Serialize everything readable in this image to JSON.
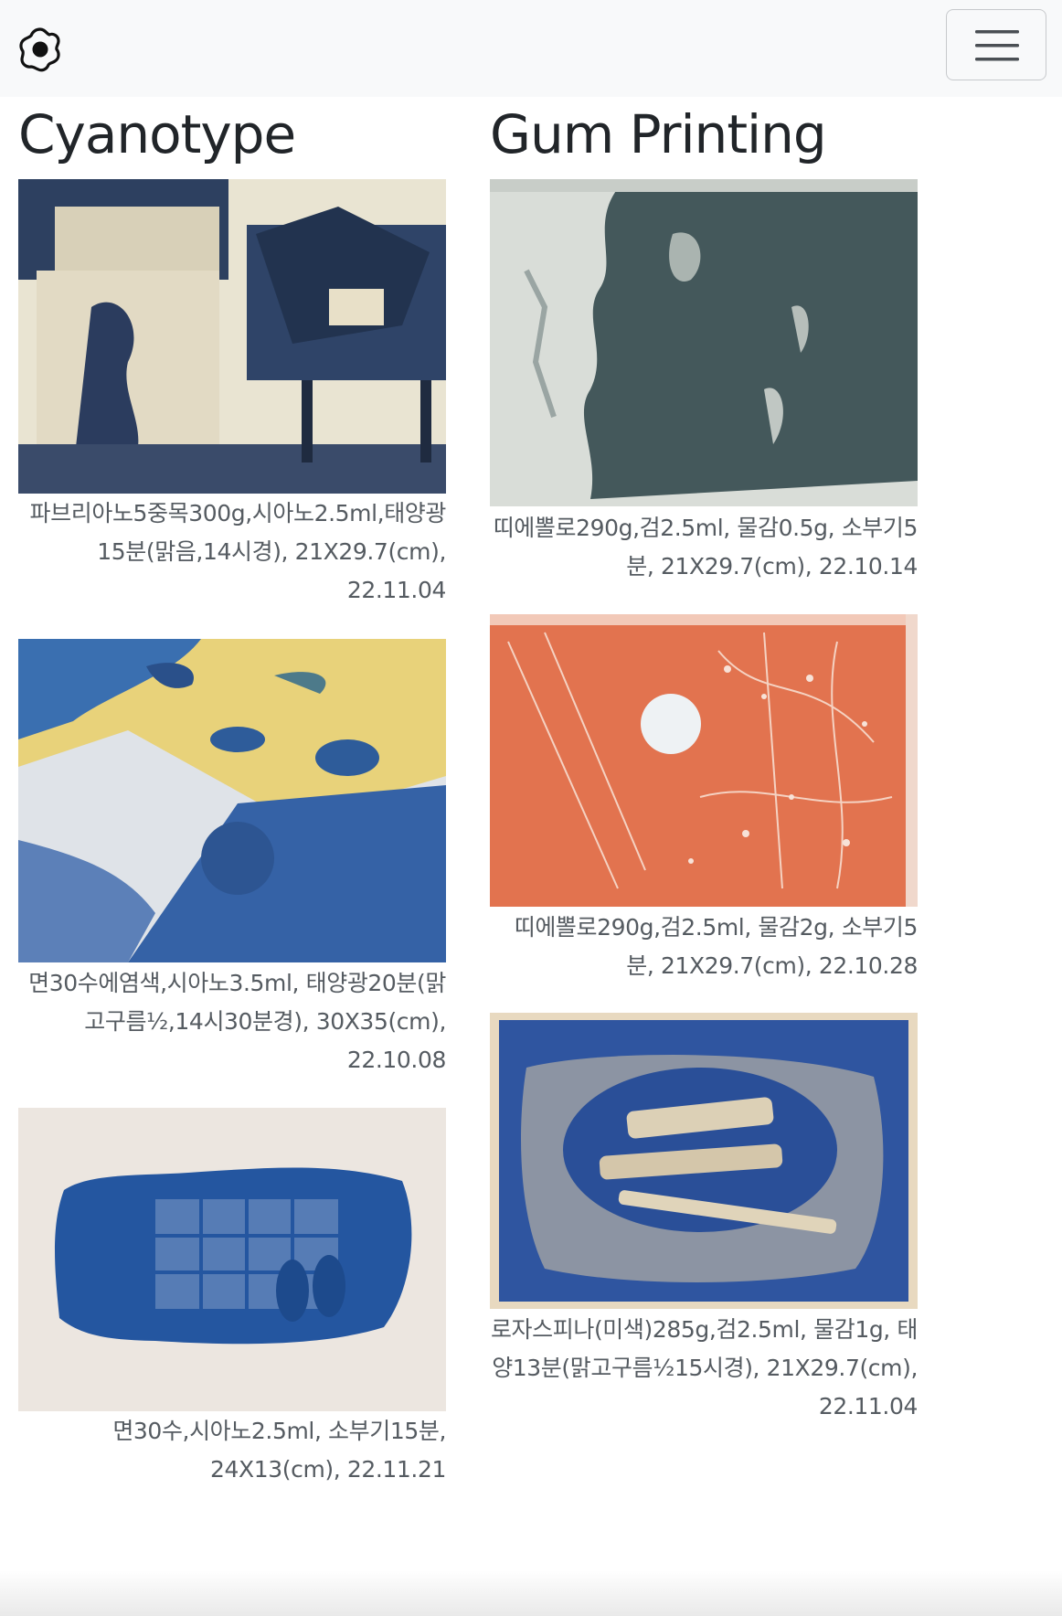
{
  "navbar": {
    "logo_icon": "flower-logo-icon",
    "menu_icon": "hamburger-menu-icon"
  },
  "columns": [
    {
      "title": "Cyanotype",
      "items": [
        {
          "caption": "파브리아노5중목300g,시아노2.5ml,태양광15분(맑음,14시경), 21X29.7(cm), 22.11.04"
        },
        {
          "caption": "면30수에염색,시아노3.5ml, 태양광20분(맑고구름½,14시30분경), 30X35(cm), 22.10.08"
        },
        {
          "caption": "면30수,시아노2.5ml, 소부기15분, 24X13(cm), 22.11.21"
        }
      ]
    },
    {
      "title": "Gum Printing",
      "items": [
        {
          "caption": "띠에뽈로290g,검2.5ml, 물감0.5g, 소부기5분, 21X29.7(cm), 22.10.14"
        },
        {
          "caption": "띠에뽈로290g,검2.5ml, 물감2g, 소부기5분, 21X29.7(cm), 22.10.28"
        },
        {
          "caption": "로자스피나(미색)285g,검2.5ml, 물감1g, 태양13분(맑고구름½15시경), 21X29.7(cm), 22.11.04"
        }
      ]
    }
  ]
}
